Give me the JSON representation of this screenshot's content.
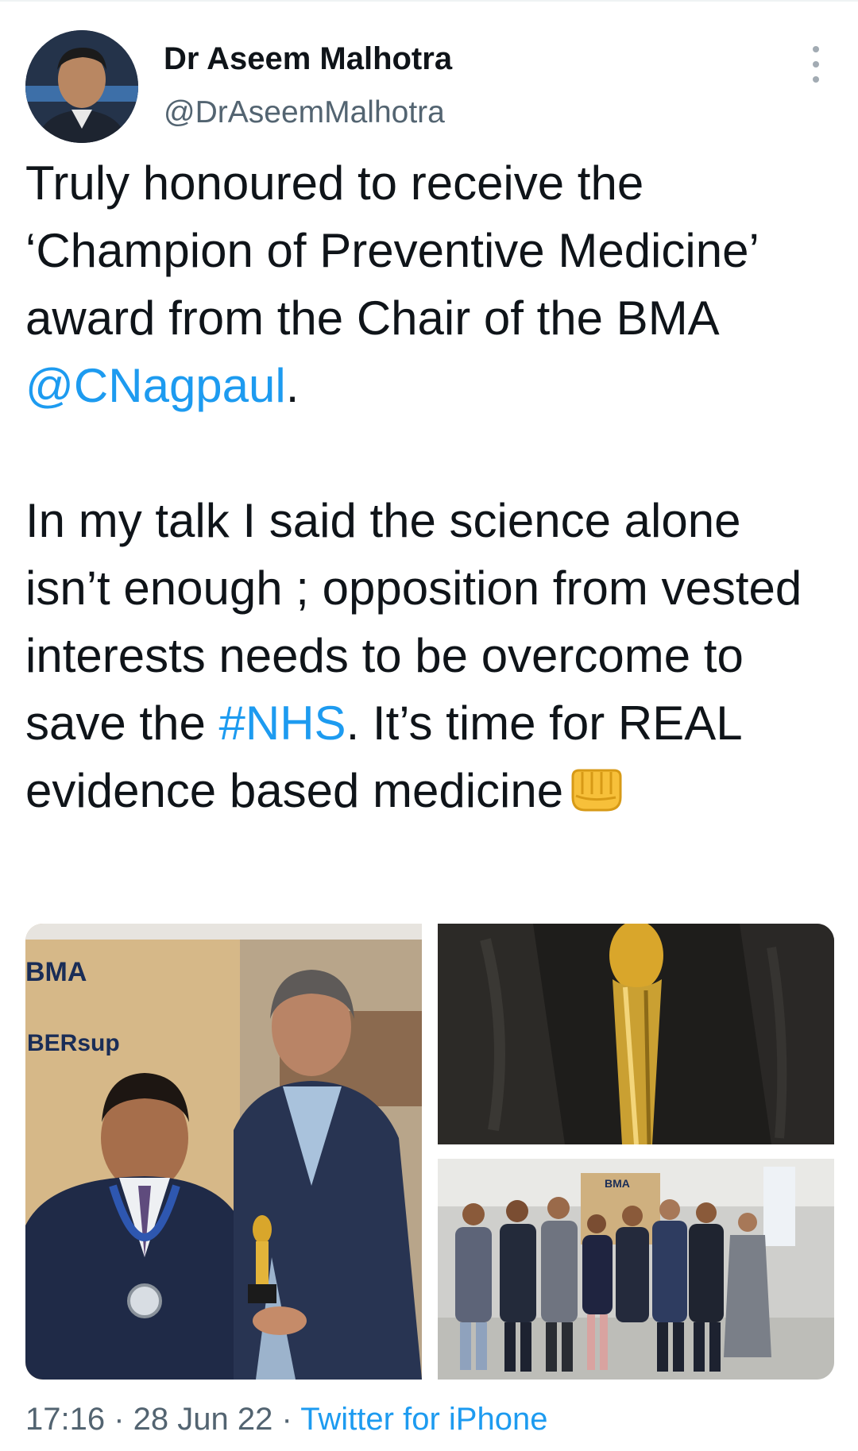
{
  "author": {
    "display_name": "Dr Aseem Malhotra",
    "handle": "@DrAseemMalhotra"
  },
  "tweet": {
    "p1_before": "Truly honoured to receive the ‘Champion of Preventive Medicine’ award from the Chair of the BMA ",
    "p1_mention": "@CNagpaul",
    "p1_after": ".",
    "p2_before": "In my talk I said the science alone isn’t enough ; opposition from vested interests needs to be overcome to save the ",
    "p2_hashtag": "#NHS",
    "p2_after": ". It’s time for REAL evidence based medicine",
    "emoji": "oncoming-fist-icon"
  },
  "media": {
    "photo1_text_bma": "BMA",
    "photo1_text_sup": "BERsup",
    "photo3_text_bma": "BMA"
  },
  "meta": {
    "time": "17:16",
    "sep1": " · ",
    "date": "28 Jun 22",
    "sep2": " · ",
    "source": "Twitter for iPhone"
  },
  "colors": {
    "link": "#1d9bf0",
    "secondary_text": "#536471",
    "primary_text": "#0f1419"
  }
}
